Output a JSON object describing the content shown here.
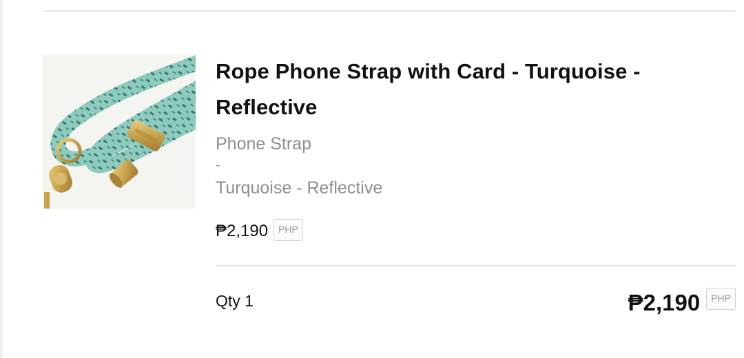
{
  "item": {
    "title": "Rope Phone Strap with Card - Turquoise - Reflective",
    "variant": {
      "type": "Phone Strap",
      "separator": "-",
      "option": "Turquoise - Reflective"
    },
    "unit_price": "₱2,190",
    "currency": "PHP",
    "qty_label": "Qty 1",
    "total_price": "₱2,190",
    "total_currency": "PHP",
    "image_icon": "rope-phone-strap-image"
  },
  "colors": {
    "rope": "#8fcbbd",
    "rope_pattern": "#2f7a75",
    "metal": "#d4b15c",
    "divider": "#e4e4e4",
    "muted_text": "#8e8e8e"
  }
}
